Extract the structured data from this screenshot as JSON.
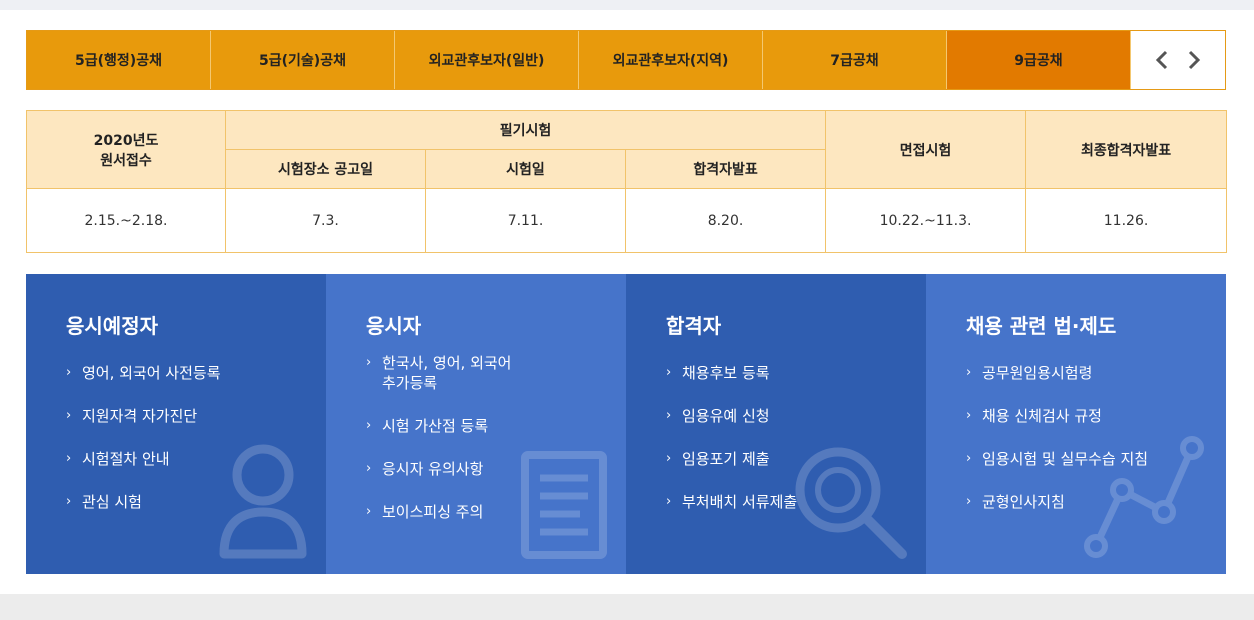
{
  "tabs": [
    {
      "label": "5급(행정)공채",
      "active": false
    },
    {
      "label": "5급(기술)공채",
      "active": false
    },
    {
      "label": "외교관후보자(일반)",
      "active": false
    },
    {
      "label": "외교관후보자(지역)",
      "active": false
    },
    {
      "label": "7급공채",
      "active": false
    },
    {
      "label": "9급공채",
      "active": true
    }
  ],
  "schedule": {
    "headers": {
      "apply_line1": "2020년도",
      "apply_line2": "원서접수",
      "written": "필기시험",
      "venue_notice": "시험장소 공고일",
      "exam_day": "시험일",
      "pass_announce": "합격자발표",
      "interview": "면접시험",
      "final": "최종합격자발표"
    },
    "values": {
      "apply": "2.15.~2.18.",
      "venue_notice": "7.3.",
      "exam_day": "7.11.",
      "pass_announce": "8.20.",
      "interview": "10.22.~11.3.",
      "final": "11.26."
    }
  },
  "panels": [
    {
      "title": "응시예정자",
      "items": [
        "영어, 외국어 사전등록",
        "지원자격 자가진단",
        "시험절차 안내",
        "관심 시험"
      ]
    },
    {
      "title": "응시자",
      "items_first_line1": "한국사, 영어, 외국어",
      "items_first_line2": "추가등록",
      "items": [
        "시험 가산점 등록",
        "응시자 유의사항",
        "보이스피싱 주의"
      ]
    },
    {
      "title": "합격자",
      "items": [
        "채용후보 등록",
        "임용유예 신청",
        "임용포기 제출",
        "부처배치 서류제출"
      ]
    },
    {
      "title": "채용 관련 법·제도",
      "items": [
        "공무원임용시험령",
        "채용 신체검사 규정",
        "임용시험 및 실무수습 지침",
        "균형인사지침"
      ]
    }
  ],
  "colors": {
    "tab": "#e89a0c",
    "tab_active": "#e27a00",
    "table_header": "#fde7c0",
    "panel_dark": "#2f5db0",
    "panel_light": "#4674ca"
  },
  "icons": [
    "chevron-left-icon",
    "chevron-right-icon",
    "person-icon",
    "document-icon",
    "magnifier-icon",
    "graph-icon"
  ]
}
